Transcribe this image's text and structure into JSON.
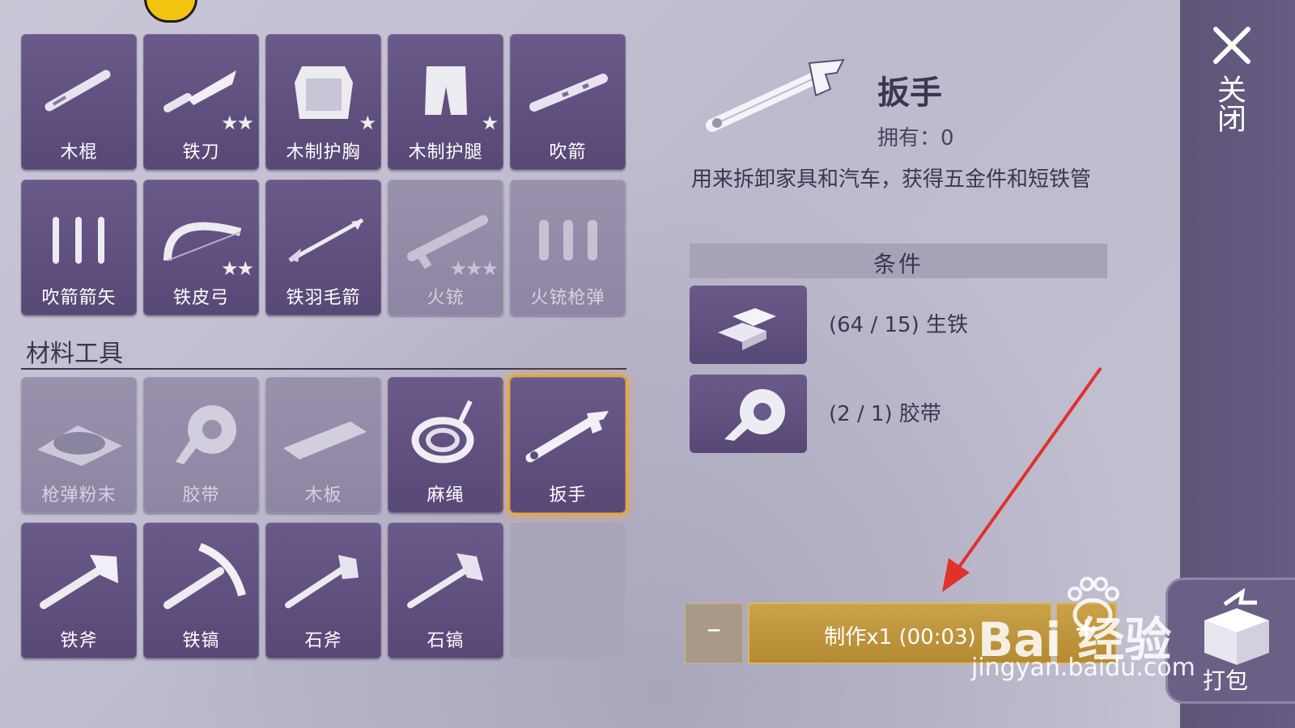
{
  "recipes_top": [
    {
      "label": "木棍",
      "stars": "",
      "icon": "wooden-stick-icon",
      "state": "normal"
    },
    {
      "label": "铁刀",
      "stars": "★★",
      "icon": "iron-knife-icon",
      "state": "normal"
    },
    {
      "label": "木制护胸",
      "stars": "★",
      "icon": "wooden-chestguard-icon",
      "state": "normal"
    },
    {
      "label": "木制护腿",
      "stars": "★",
      "icon": "wooden-legguard-icon",
      "state": "normal"
    },
    {
      "label": "吹箭",
      "stars": "",
      "icon": "blowgun-icon",
      "state": "normal"
    },
    {
      "label": "吹箭箭矢",
      "stars": "",
      "icon": "blowgun-darts-icon",
      "state": "normal"
    },
    {
      "label": "铁皮弓",
      "stars": "★★",
      "icon": "iron-bow-icon",
      "state": "normal"
    },
    {
      "label": "铁羽毛箭",
      "stars": "",
      "icon": "iron-arrow-icon",
      "state": "normal"
    },
    {
      "label": "火铳",
      "stars": "★★★",
      "icon": "musket-icon",
      "state": "dim"
    },
    {
      "label": "火铳枪弹",
      "stars": "",
      "icon": "musket-ammo-icon",
      "state": "dim"
    }
  ],
  "section_title": "材料工具",
  "recipes_tools": [
    {
      "label": "枪弹粉末",
      "icon": "gunpowder-icon",
      "state": "dim"
    },
    {
      "label": "胶带",
      "icon": "tape-icon",
      "state": "dim"
    },
    {
      "label": "木板",
      "icon": "wood-plank-icon",
      "state": "dim"
    },
    {
      "label": "麻绳",
      "icon": "rope-icon",
      "state": "normal"
    },
    {
      "label": "扳手",
      "icon": "wrench-icon",
      "state": "selected"
    },
    {
      "label": "铁斧",
      "icon": "iron-axe-icon",
      "state": "normal"
    },
    {
      "label": "铁镐",
      "icon": "iron-pickaxe-icon",
      "state": "normal"
    },
    {
      "label": "石斧",
      "icon": "stone-axe-icon",
      "state": "normal"
    },
    {
      "label": "石镐",
      "icon": "stone-pickaxe-icon",
      "state": "normal"
    }
  ],
  "detail": {
    "name": "扳手",
    "owned": "拥有：0",
    "description": "用来拆卸家具和汽车，获得五金件和短铁管",
    "condition_header": "条件",
    "requirements": [
      {
        "text": "(64 / 15) 生铁",
        "icon": "pig-iron-icon"
      },
      {
        "text": "(2 / 1) 胶带",
        "icon": "tape-icon"
      }
    ]
  },
  "craft": {
    "minus": "–",
    "button": "制作x1 (00:03)",
    "plus": "+"
  },
  "side": {
    "close": "关闭",
    "pack": "打包"
  },
  "watermark": {
    "brand": "Bai 经验",
    "url": "jingyan.baidu.com"
  },
  "colors": {
    "accent": "#e9a63a",
    "cell": "#5e4e7e",
    "craft": "#c09a3f",
    "panel": "#655b80"
  }
}
